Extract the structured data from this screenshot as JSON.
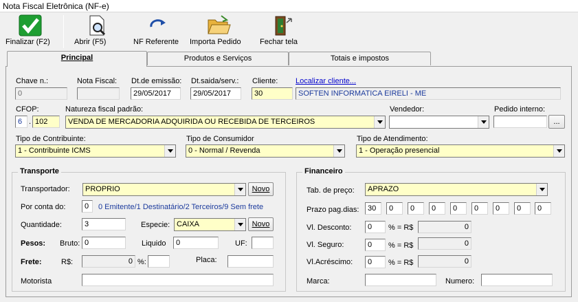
{
  "window": {
    "title": "Nota Fiscal Eletrônica (NF-e)"
  },
  "toolbar": {
    "finalizar": "Finalizar (F2)",
    "abrir": "Abrir (F5)",
    "nf_referente": "NF Referente",
    "importa_pedido": "Importa Pedido",
    "fechar_tela": "Fechar tela"
  },
  "tabs": {
    "principal": "Principal",
    "produtos": "Produtos e Serviços",
    "totais": "Totais e impostos"
  },
  "header": {
    "chave_label": "Chave n.:",
    "chave_value": "0",
    "nota_label": "Nota Fiscal:",
    "nota_value": "",
    "emissao_label": "Dt.de emissão:",
    "emissao_value": "29/05/2017",
    "saida_label": "Dt.saida/serv.:",
    "saida_value": "29/05/2017",
    "cliente_label": "Cliente:",
    "cliente_value": "30",
    "localizar": "Localizar cliente...",
    "cliente_nome": "SOFTEN INFORMATICA EIRELI - ME"
  },
  "cfop": {
    "label": "CFOP:",
    "prefix": "6",
    "dot": ".",
    "code": "102",
    "natureza_label": "Natureza fiscal padrão:",
    "natureza_value": "VENDA DE MERCADORIA ADQUIRIDA OU RECEBIDA DE TERCEIROS",
    "vendedor_label": "Vendedor:",
    "vendedor_value": "",
    "pedido_label": "Pedido interno:",
    "pedido_value": "",
    "pedido_btn": "..."
  },
  "tipos": {
    "contribuinte_label": "Tipo de Contribuinte:",
    "contribuinte_value": "1 - Contribuinte ICMS",
    "consumidor_label": "Tipo de Consumidor",
    "consumidor_value": "0 - Normal / Revenda",
    "atendimento_label": "Tipo de Atendimento:",
    "atendimento_value": "1 - Operação presencial"
  },
  "transporte": {
    "title": "Transporte",
    "transportador_label": "Transportador:",
    "transportador_value": "PROPRIO",
    "novo": "Novo",
    "conta_label": "Por conta do:",
    "conta_value": "0",
    "conta_help": "0 Emitente/1 Destinatário/2 Terceiros/9 Sem frete",
    "quantidade_label": "Quantidade:",
    "quantidade_value": "3",
    "especie_label": "Especie:",
    "especie_value": "CAIXA",
    "novo2": "Novo",
    "pesos_label": "Pesos:",
    "bruto_label": "Bruto:",
    "bruto_value": "0",
    "liquido_label": "Liquido",
    "liquido_value": "0",
    "uf_label": "UF:",
    "uf_value": "",
    "frete_label": "Frete:",
    "rs_label": "R$:",
    "frete_value": "0",
    "pct_label": "%:",
    "pct_value": "",
    "placa_label": "Placa:",
    "placa_value": "",
    "motorista_label": "Motorista",
    "motorista_value": ""
  },
  "financeiro": {
    "title": "Financeiro",
    "tabela_label": "Tab. de preço:",
    "tabela_value": "APRAZO",
    "prazo_label": "Prazo pag.dias:",
    "prazo_values": [
      "30",
      "0",
      "0",
      "0",
      "0",
      "0",
      "0",
      "0",
      "0"
    ],
    "desconto_label": "Vl. Desconto:",
    "desconto_pct": "0",
    "desconto_eq": "% = R$",
    "desconto_value": "0",
    "seguro_label": "Vl. Seguro:",
    "seguro_pct": "0",
    "seguro_eq": "% = R$",
    "seguro_value": "0",
    "acrescimo_label": "Vl.Acréscimo:",
    "acrescimo_pct": "0",
    "acrescimo_eq": "% = R$",
    "acrescimo_value": "0",
    "marca_label": "Marca:",
    "marca_value": "",
    "numero_label": "Numero:",
    "numero_value": ""
  }
}
